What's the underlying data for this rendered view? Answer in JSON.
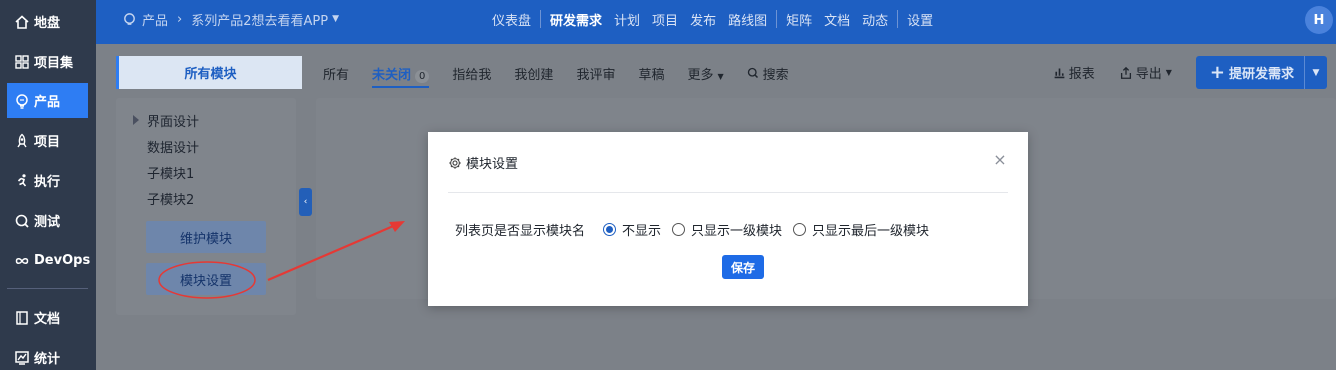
{
  "nav": {
    "items": [
      {
        "label": "地盘",
        "icon": "home-icon"
      },
      {
        "label": "项目集",
        "icon": "grid-icon"
      },
      {
        "label": "产品",
        "icon": "lightbulb-icon"
      },
      {
        "label": "项目",
        "icon": "rocket-icon"
      },
      {
        "label": "执行",
        "icon": "run-icon"
      },
      {
        "label": "测试",
        "icon": "bug-search-icon"
      },
      {
        "label": "DevOps",
        "icon": "infinity-icon"
      },
      {
        "label": "文档",
        "icon": "book-icon"
      },
      {
        "label": "统计",
        "icon": "chart-icon"
      }
    ],
    "active_index": 2
  },
  "header": {
    "product_label": "产品",
    "product_name": "系列产品2想去看看APP",
    "menu": [
      "仪表盘",
      "研发需求",
      "计划",
      "项目",
      "发布",
      "路线图",
      "矩阵",
      "文档",
      "动态",
      "设置"
    ],
    "active_menu": "研发需求",
    "avatar_initial": "H"
  },
  "content": {
    "module_tab": "所有模块",
    "subnav": {
      "all": "所有",
      "unclosed": "未关闭",
      "unclosed_count": "0",
      "assigned": "指给我",
      "created": "我创建",
      "reviewed": "我评审",
      "draft": "草稿",
      "more": "更多",
      "search": "搜索"
    },
    "toolbar": {
      "report": "报表",
      "export": "导出",
      "create": "提研发需求"
    },
    "tree": [
      "界面设计",
      "数据设计",
      "子模块1",
      "子模块2"
    ],
    "maintain_button": "维护模块",
    "settings_button": "模块设置"
  },
  "modal": {
    "title": "模块设置",
    "close_symbol": "×",
    "field_label": "列表页是否显示模块名",
    "options": [
      "不显示",
      "只显示一级模块",
      "只显示最后一级模块"
    ],
    "selected_option": "不显示",
    "save_label": "保存"
  },
  "colors": {
    "nav_bg": "#2f3a4c",
    "header_bg": "#1e5fc2",
    "accent": "#2e7df3",
    "annotation": "#e53935"
  }
}
